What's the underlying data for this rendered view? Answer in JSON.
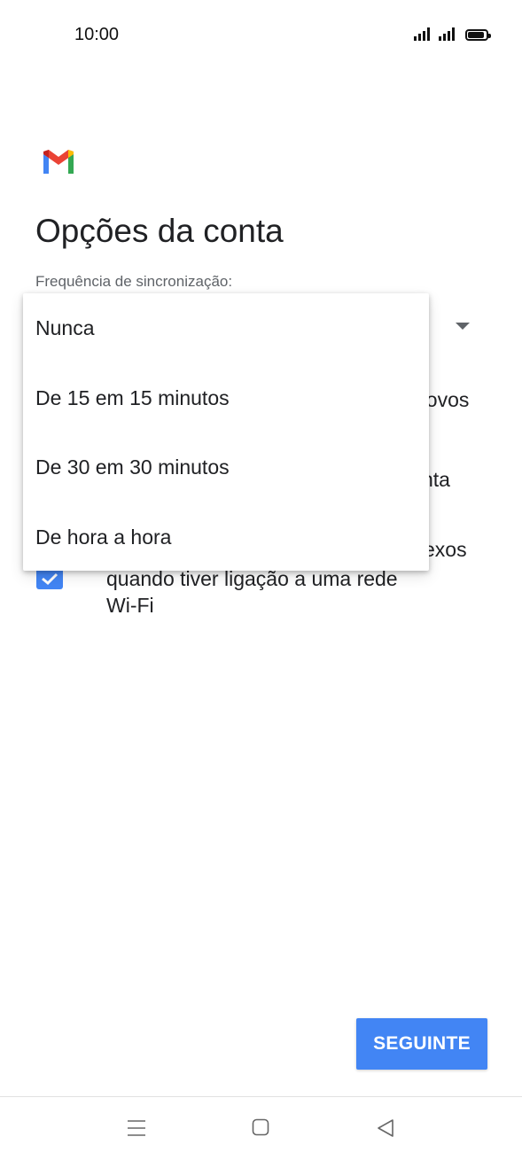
{
  "status_bar": {
    "time": "10:00",
    "icons": [
      "signal-icon",
      "signal-icon",
      "battery-icon"
    ],
    "battery_level": 0.9
  },
  "app": {
    "logo": "gmail-logo",
    "colors": {
      "red": "#ea4335",
      "blue": "#4285f4",
      "yellow": "#fbbc04",
      "green": "#34a853"
    }
  },
  "page": {
    "title": "Opções da conta",
    "sync_label": "Frequência de sincronização:"
  },
  "dropdown": {
    "options": [
      "Nunca",
      "De 15 em 15 minutos",
      "De 30 em 30 minutos",
      "De hora a hora"
    ]
  },
  "background_options": {
    "fragment_1": "novos",
    "fragment_2": "nta",
    "fragment_3": "exos",
    "wifi_line_1": "quando tiver ligação a uma rede",
    "wifi_line_2": "Wi-Fi",
    "wifi_checked": true
  },
  "buttons": {
    "next": "SEGUINTE"
  },
  "nav_bar": {
    "icons": [
      "menu-icon",
      "home-icon",
      "back-icon"
    ]
  },
  "accent_color": "#4285f4"
}
